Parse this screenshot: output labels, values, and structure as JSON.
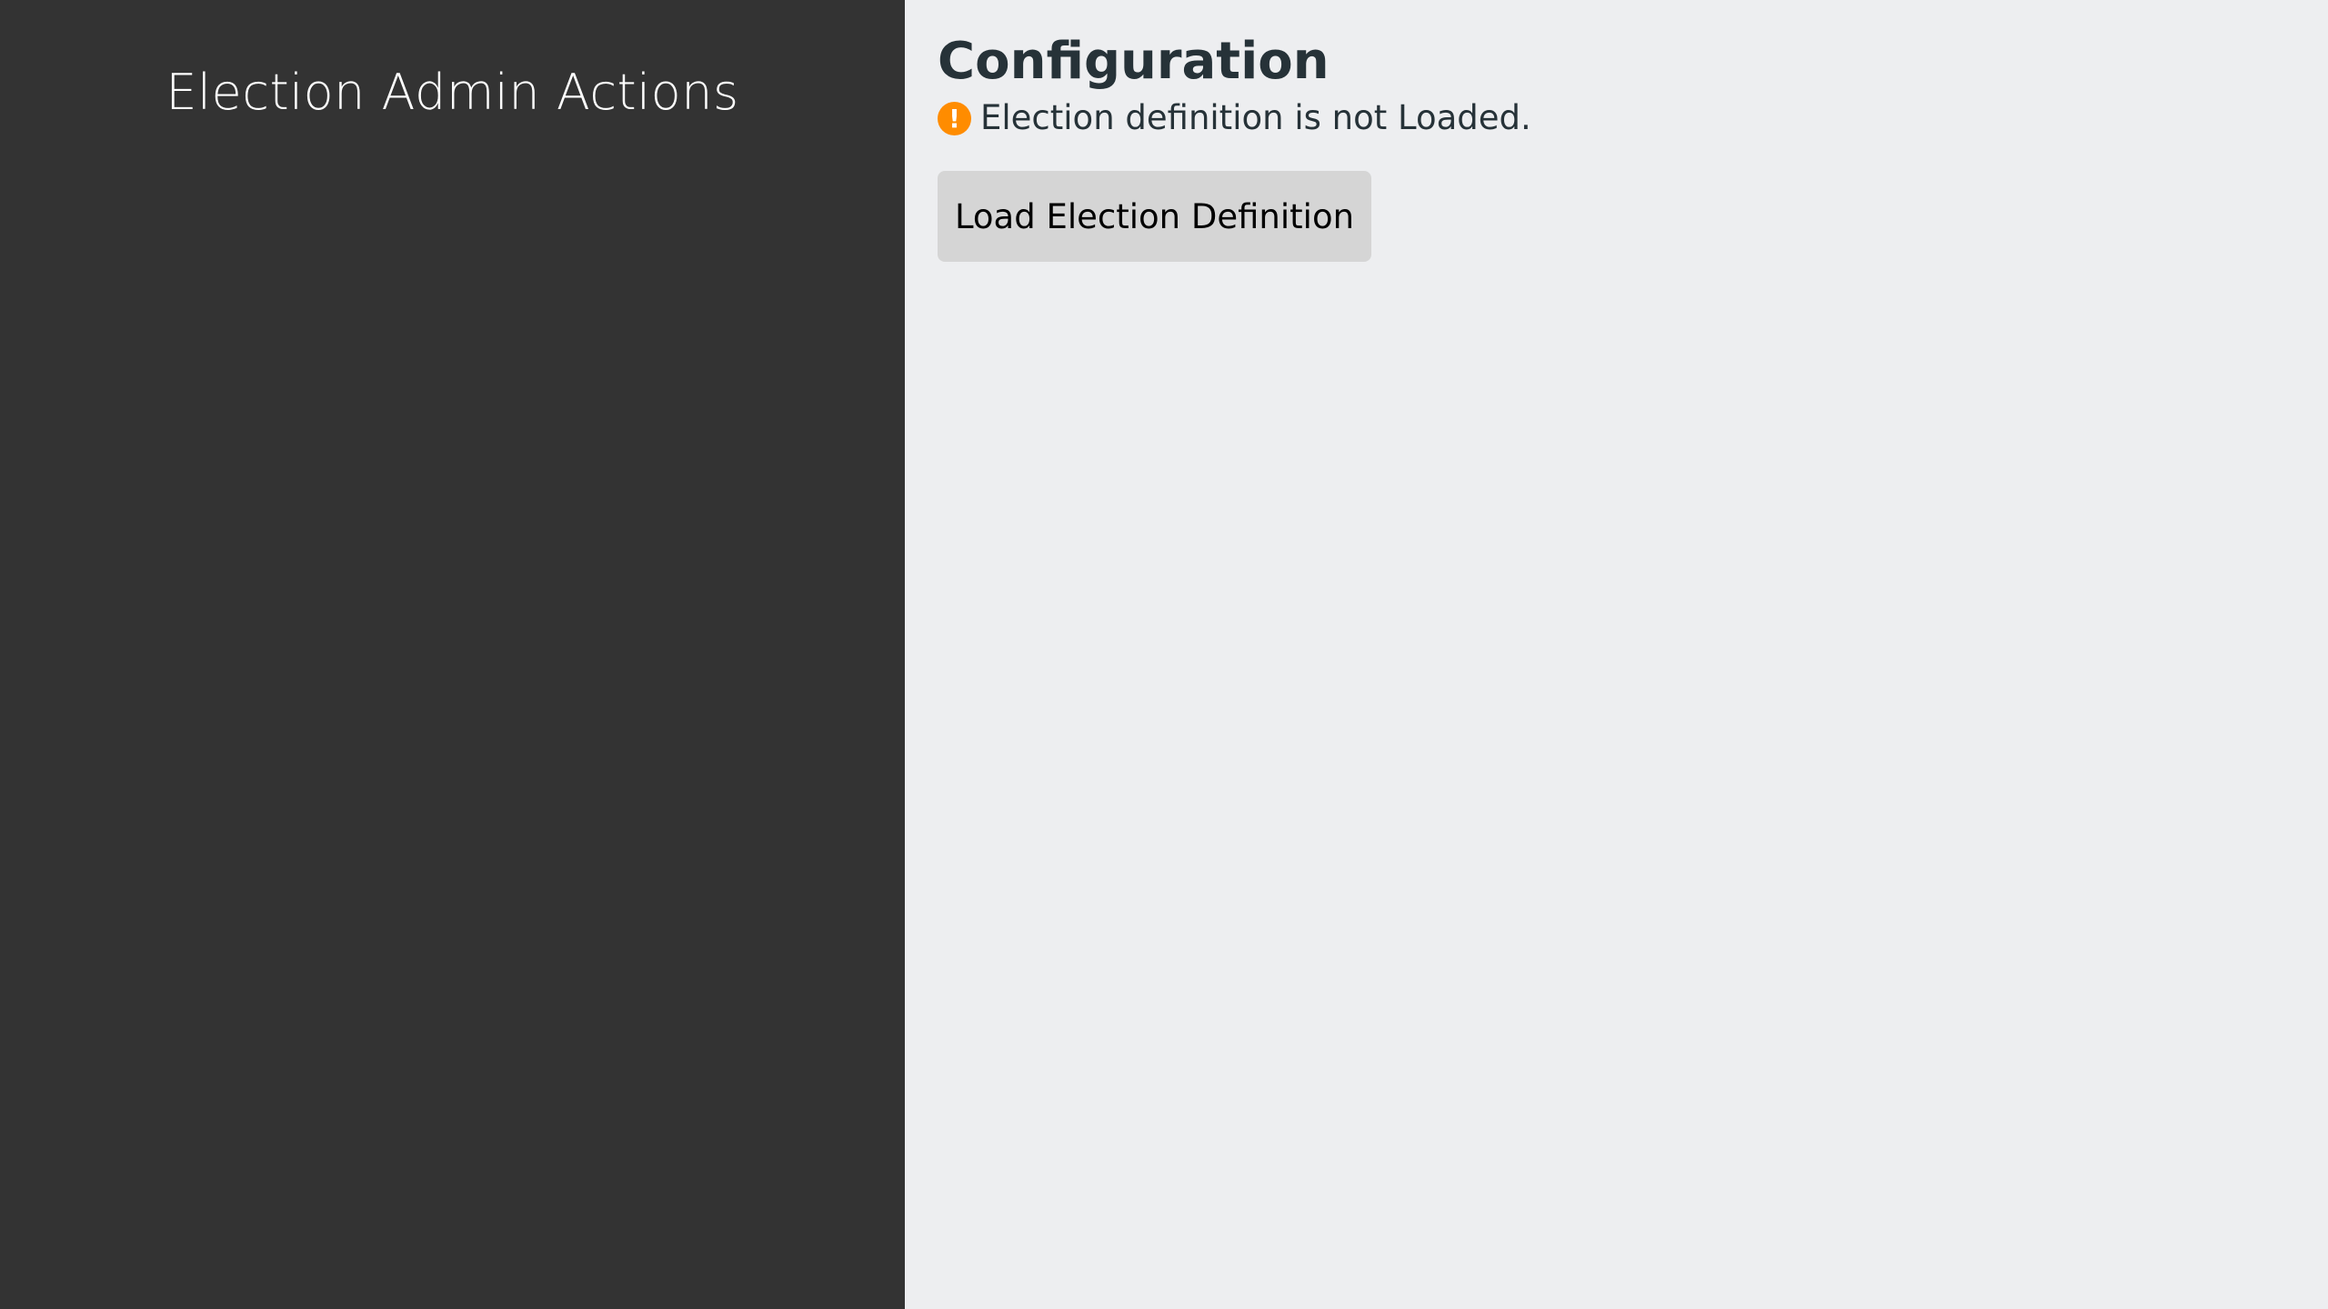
{
  "sidebar": {
    "title": "Election Admin Actions"
  },
  "main": {
    "title": "Configuration",
    "status": {
      "icon": "warning-icon",
      "icon_glyph": "!",
      "icon_color": "#ff8c00",
      "text": "Election definition is not Loaded."
    },
    "load_button_label": "Load Election Definition"
  },
  "colors": {
    "sidebar_bg": "#333333",
    "main_bg": "#edeef0",
    "button_bg": "#d5d5d5",
    "heading_text": "#263238"
  }
}
